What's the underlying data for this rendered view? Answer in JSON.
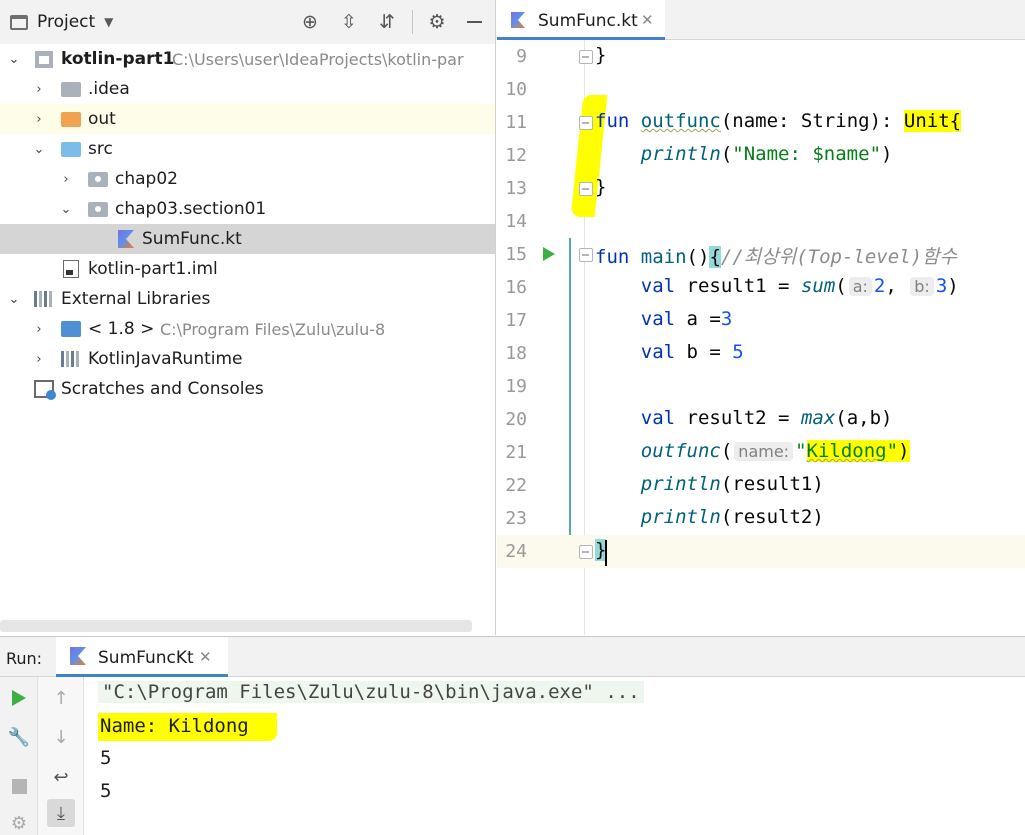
{
  "project": {
    "title": "Project",
    "tree": [
      {
        "label": "kotlin-part1",
        "path": "C:\\Users\\user\\IdeaProjects\\kotlin-par",
        "bold": true
      },
      {
        "label": ".idea"
      },
      {
        "label": "out"
      },
      {
        "label": "src"
      },
      {
        "label": "chap02"
      },
      {
        "label": "chap03.section01"
      },
      {
        "label": "SumFunc.kt"
      },
      {
        "label": "kotlin-part1.iml"
      },
      {
        "label": "External Libraries"
      },
      {
        "label": "< 1.8 >",
        "path": "C:\\Program Files\\Zulu\\zulu-8"
      },
      {
        "label": "KotlinJavaRuntime"
      },
      {
        "label": "Scratches and Consoles"
      }
    ]
  },
  "editor": {
    "tab_label": "SumFunc.kt",
    "line_numbers": [
      "9",
      "10",
      "11",
      "12",
      "13",
      "14",
      "15",
      "16",
      "17",
      "18",
      "19",
      "20",
      "21",
      "22",
      "23",
      "24"
    ],
    "tokens": {
      "fun": "fun",
      "val": "val",
      "outfunc": "outfunc",
      "main": "main",
      "println": "println",
      "sum": "sum",
      "max": "max",
      "unit": "Unit",
      "open_brace": "{",
      "close_brace": "}",
      "l11_params": "(name: String): ",
      "l12_str": "\"Name: $name\"",
      "l15_parens": "()",
      "l15_comment": "//최상위(Top-level)함수",
      "result1": " result1 = ",
      "hint_a": "a:",
      "hint_b": "b:",
      "hint_name": "name:",
      "num_2": "2",
      "num_3": "3",
      "num_5": "5",
      "a_eq": " a =",
      "b_eq": " b = ",
      "result2_eq": " result2 = ",
      "max_args": "(a,b)",
      "kildong": "Kildong",
      "quote": "\"",
      "open_paren": "(",
      "close_paren": ")",
      "comma": ", ",
      "arg_result1": "(result1)",
      "arg_result2": "(result2)"
    }
  },
  "run": {
    "title": "Run:",
    "tab_label": "SumFuncKt",
    "console": [
      "\"C:\\Program Files\\Zulu\\zulu-8\\bin\\java.exe\" ...",
      "Name: Kildong",
      "5",
      "5"
    ]
  },
  "colors": {
    "accent": "#4083c9",
    "highlight": "#ffff00",
    "keyword": "#0033b3",
    "function": "#00627a",
    "string": "#067d17",
    "number": "#1750eb"
  }
}
